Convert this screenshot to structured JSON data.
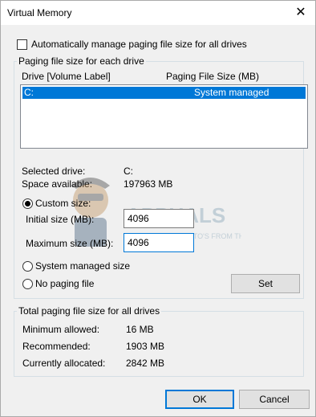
{
  "window": {
    "title": "Virtual Memory"
  },
  "auto_manage": {
    "label": "Automatically manage paging file size for all drives",
    "checked": false
  },
  "paging_group": {
    "title": "Paging file size for each drive",
    "col_drive": "Drive  [Volume Label]",
    "col_size": "Paging File Size (MB)",
    "rows": [
      {
        "drive": "C:",
        "size": "System managed",
        "selected": true
      }
    ]
  },
  "selected_info": {
    "drive_label": "Selected drive:",
    "drive_value": "C:",
    "space_label": "Space available:",
    "space_value": "197963 MB"
  },
  "size_options": {
    "custom_label": "Custom size:",
    "initial_label": "Initial size (MB):",
    "initial_value": "4096",
    "max_label": "Maximum size (MB):",
    "max_value": "4096",
    "system_label": "System managed size",
    "none_label": "No paging file",
    "selected": "custom",
    "set_button": "Set"
  },
  "watermark": {
    "brand": "APPUALS",
    "tagline": "TECH HOW-TO'S FROM THE EXPERTS!"
  },
  "total_group": {
    "title": "Total paging file size for all drives",
    "min_label": "Minimum allowed:",
    "min_value": "16 MB",
    "rec_label": "Recommended:",
    "rec_value": "1903 MB",
    "alloc_label": "Currently allocated:",
    "alloc_value": "2842 MB"
  },
  "footer": {
    "ok": "OK",
    "cancel": "Cancel"
  }
}
